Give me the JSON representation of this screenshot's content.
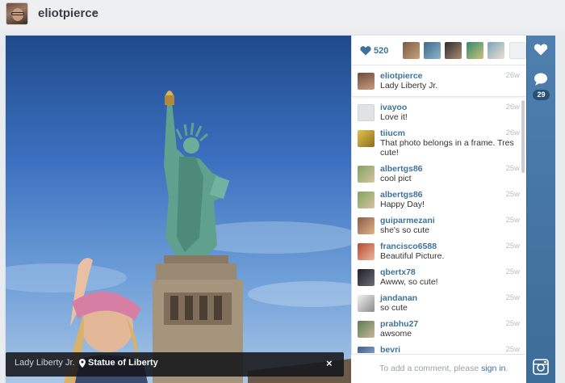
{
  "header": {
    "username": "eliotpierce",
    "caret": "▾"
  },
  "photo": {
    "caption": "Lady Liberty Jr.",
    "location": "Statue of Liberty",
    "close_label": "×"
  },
  "likes": {
    "count": "520"
  },
  "owner_comment": {
    "user": "eliotpierce",
    "text": "Lady Liberty Jr.",
    "time": "26w"
  },
  "comments": [
    {
      "user": "ivayoo",
      "text": "Love it!",
      "time": "26w",
      "avatar_color": "#dfe3e6"
    },
    {
      "user": "tiiucm",
      "text": "That photo belongs in a frame. Tres cute!",
      "time": "26w",
      "avatar_color": "#d9b73a"
    },
    {
      "user": "albertgs86",
      "text": "cool pict",
      "time": "25w",
      "avatar_color": "#6a8e4f"
    },
    {
      "user": "albertgs86",
      "text": "Happy Day!",
      "time": "25w",
      "avatar_color": "#6a8e4f"
    },
    {
      "user": "guiparmezani",
      "text": "she's so cute",
      "time": "25w",
      "avatar_color": "#8c5b42"
    },
    {
      "user": "francisco6588",
      "text": "Beautiful Picture.",
      "time": "25w",
      "avatar_color": "#b9462f"
    },
    {
      "user": "qbertx78",
      "text": "Awww, so cute!",
      "time": "25w",
      "avatar_color": "#2e2e35"
    },
    {
      "user": "jandanan",
      "text": "so cute",
      "time": "25w",
      "avatar_color": "#e7e7e7"
    },
    {
      "user": "prabhu27",
      "text": "awsome",
      "time": "25w",
      "avatar_color": "#5d7a52"
    },
    {
      "user": "bevri",
      "text": "",
      "time": "25w",
      "avatar_color": "#3c5f8c"
    }
  ],
  "comment_box": {
    "placeholder": "To add a comment, please ",
    "signin": "sign in",
    "period": "."
  },
  "strip": {
    "comment_count": "29"
  },
  "colors": {
    "link": "#3f729b",
    "strip": "#4a7aa8",
    "time": "#b8bec3"
  },
  "icons": [
    "heart-icon",
    "comment-bubble-icon",
    "location-pin-icon",
    "close-icon",
    "instagram-logo-icon",
    "chevron-down-icon"
  ]
}
